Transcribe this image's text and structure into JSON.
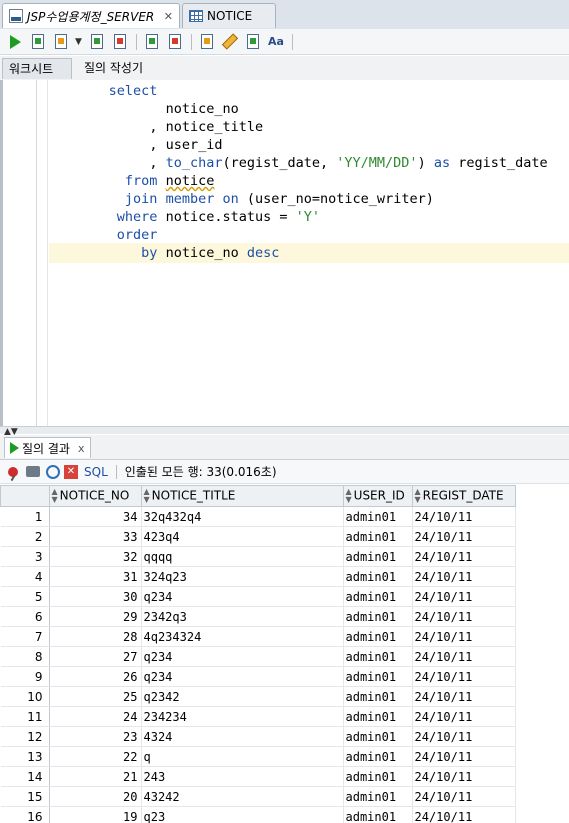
{
  "tabs": [
    {
      "label": "JSP수업용계정_SERVER",
      "icon": "sql-worksheet-icon",
      "active": true
    },
    {
      "label": "NOTICE",
      "icon": "table-grid-icon",
      "active": false
    }
  ],
  "subtabs": {
    "worksheet": "워크시트",
    "query_builder": "질의 작성기"
  },
  "editor": {
    "lines": [
      {
        "indent": "             ",
        "parts": [
          {
            "t": "select",
            "c": "kw"
          }
        ]
      },
      {
        "indent": "                    ",
        "parts": [
          {
            "t": "notice_no",
            "c": "plain"
          }
        ]
      },
      {
        "indent": "                  ",
        "parts": [
          {
            "t": ", notice_title",
            "c": "plain"
          }
        ]
      },
      {
        "indent": "                  ",
        "parts": [
          {
            "t": ", user_id",
            "c": "plain"
          }
        ]
      },
      {
        "indent": "                  ",
        "parts": [
          {
            "t": ", ",
            "c": "plain"
          },
          {
            "t": "to_char",
            "c": "fn"
          },
          {
            "t": "(regist_date, ",
            "c": "plain"
          },
          {
            "t": "'YY/MM/DD'",
            "c": "str"
          },
          {
            "t": ") ",
            "c": "plain"
          },
          {
            "t": "as",
            "c": "kw"
          },
          {
            "t": " regist_date",
            "c": "plain"
          }
        ]
      },
      {
        "indent": "               ",
        "parts": [
          {
            "t": "from",
            "c": "kw"
          },
          {
            "t": " ",
            "c": "plain"
          },
          {
            "t": "notice",
            "c": "plain wave"
          }
        ]
      },
      {
        "indent": "               ",
        "parts": [
          {
            "t": "join",
            "c": "kw"
          },
          {
            "t": " ",
            "c": "plain"
          },
          {
            "t": "member",
            "c": "kw"
          },
          {
            "t": " ",
            "c": "plain"
          },
          {
            "t": "on",
            "c": "kw"
          },
          {
            "t": " (user_no=notice_writer)",
            "c": "plain"
          }
        ]
      },
      {
        "indent": "              ",
        "parts": [
          {
            "t": "where",
            "c": "kw"
          },
          {
            "t": " notice.status = ",
            "c": "plain"
          },
          {
            "t": "'Y'",
            "c": "str"
          }
        ]
      },
      {
        "indent": "              ",
        "parts": [
          {
            "t": "order",
            "c": "kw"
          }
        ]
      },
      {
        "indent": "                 ",
        "parts": [
          {
            "t": "by",
            "c": "kw"
          },
          {
            "t": " notice_no ",
            "c": "plain"
          },
          {
            "t": "desc",
            "c": "kw"
          }
        ]
      }
    ]
  },
  "results": {
    "tab_label": "질의 결과",
    "tab_close": "x",
    "sql_link": "SQL",
    "row_status": "인출된 모든 행: 33(0.016초)",
    "columns": [
      "NOTICE_NO",
      "NOTICE_TITLE",
      "USER_ID",
      "REGIST_DATE"
    ],
    "rows": [
      [
        "1",
        "34",
        "32q432q4",
        "admin01",
        "24/10/11"
      ],
      [
        "2",
        "33",
        "423q4",
        "admin01",
        "24/10/11"
      ],
      [
        "3",
        "32",
        "qqqq",
        "admin01",
        "24/10/11"
      ],
      [
        "4",
        "31",
        "324q23",
        "admin01",
        "24/10/11"
      ],
      [
        "5",
        "30",
        "q234",
        "admin01",
        "24/10/11"
      ],
      [
        "6",
        "29",
        "2342q3",
        "admin01",
        "24/10/11"
      ],
      [
        "7",
        "28",
        "4q234324",
        "admin01",
        "24/10/11"
      ],
      [
        "8",
        "27",
        "q234",
        "admin01",
        "24/10/11"
      ],
      [
        "9",
        "26",
        "q234",
        "admin01",
        "24/10/11"
      ],
      [
        "10",
        "25",
        "q2342",
        "admin01",
        "24/10/11"
      ],
      [
        "11",
        "24",
        "234234",
        "admin01",
        "24/10/11"
      ],
      [
        "12",
        "23",
        "4324",
        "admin01",
        "24/10/11"
      ],
      [
        "13",
        "22",
        "q",
        "admin01",
        "24/10/11"
      ],
      [
        "14",
        "21",
        "243",
        "admin01",
        "24/10/11"
      ],
      [
        "15",
        "20",
        "43242",
        "admin01",
        "24/10/11"
      ],
      [
        "16",
        "19",
        "q23",
        "admin01",
        "24/10/11"
      ]
    ]
  }
}
